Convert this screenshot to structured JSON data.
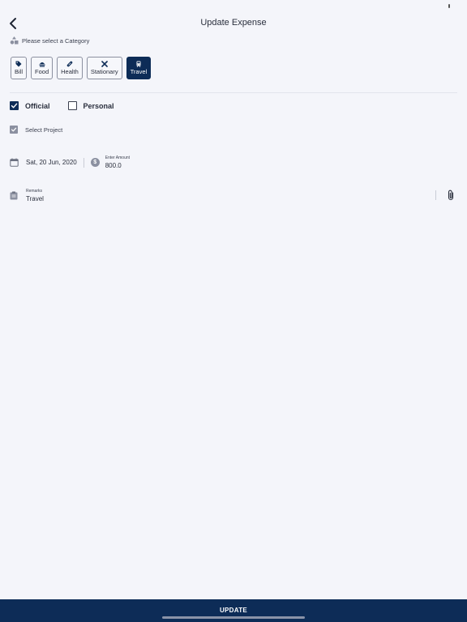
{
  "header": {
    "title": "Update Expense"
  },
  "category": {
    "hint": "Please select a Category",
    "items": [
      {
        "label": "Bill",
        "icon": "tag-icon",
        "selected": false
      },
      {
        "label": "Food",
        "icon": "food-icon",
        "selected": false
      },
      {
        "label": "Health",
        "icon": "medicine-icon",
        "selected": false
      },
      {
        "label": "Stationary",
        "icon": "tools-icon",
        "selected": false
      },
      {
        "label": "Travel",
        "icon": "train-icon",
        "selected": true
      }
    ]
  },
  "expense_type": {
    "official": {
      "label": "Official",
      "checked": true
    },
    "personal": {
      "label": "Personal",
      "checked": false
    }
  },
  "project": {
    "label": "Select Project"
  },
  "date": {
    "value": "Sat, 20 Jun, 2020"
  },
  "amount": {
    "label": "Enter Amount",
    "value": "800.0"
  },
  "remarks": {
    "label": "Remarks",
    "value": "Travel"
  },
  "footer": {
    "button_label": "UPDATE"
  },
  "colors": {
    "primary": "#0d2c57",
    "background": "#f4f5fa",
    "muted": "#8b90a0"
  }
}
